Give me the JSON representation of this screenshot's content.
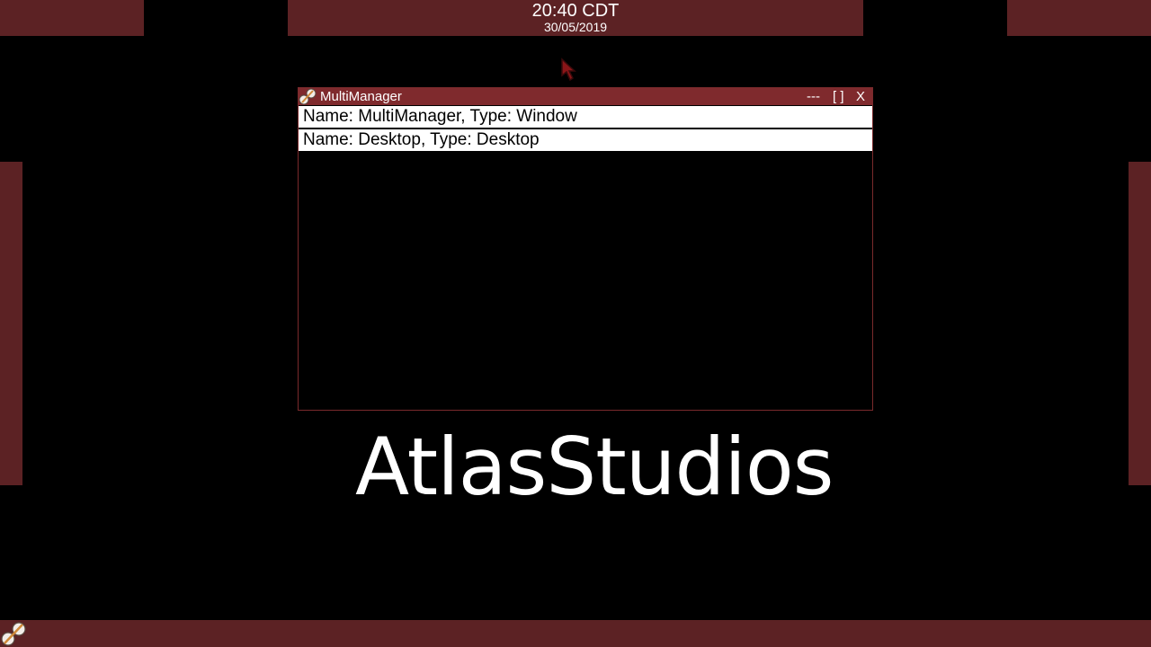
{
  "clock": {
    "time": "20:40 CDT",
    "date": "30/05/2019"
  },
  "window": {
    "title": "MultiManager",
    "minimize_label": "---",
    "maximize_label": "[ ]",
    "close_label": "X",
    "items": [
      {
        "label": "Name: MultiManager, Type: Window"
      },
      {
        "label": "Name: Desktop, Type: Desktop"
      }
    ]
  },
  "desktop": {
    "logo_text": "AtlasStudios"
  },
  "icons": {
    "window_icon": "app-logo-icon",
    "start_icon": "app-logo-icon",
    "cursor": "mouse-cursor-icon"
  },
  "colors": {
    "panel": "#5c2224",
    "titlebar": "#7f2a2d",
    "background": "#000000",
    "list_item_bg": "#ffffff",
    "text_light": "#ffffff"
  }
}
